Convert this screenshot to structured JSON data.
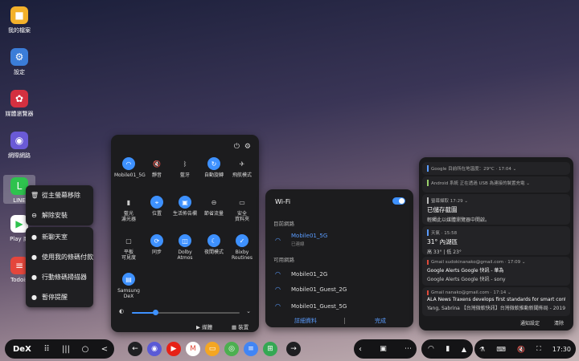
{
  "desktop": {
    "icons": [
      {
        "label": "我的檔案",
        "color": "#f3b12b",
        "glyph": "■"
      },
      {
        "label": "設定",
        "color": "#3b7dd8",
        "glyph": "⚙"
      },
      {
        "label": "媒體瀏覽器",
        "color": "#d43040",
        "glyph": "✿"
      },
      {
        "label": "網際網路",
        "color": "#6a5ad6",
        "glyph": "◉"
      },
      {
        "label": "LINE",
        "color": "#2ec24e",
        "glyph": "L"
      },
      {
        "label": "Play 商",
        "color": "#ffffff",
        "glyph": "▶"
      },
      {
        "label": "Todois",
        "color": "#e4463c",
        "glyph": "≡"
      }
    ]
  },
  "context_menu": {
    "group1": [
      {
        "label": "從主螢幕移除",
        "icon": "trash-icon"
      },
      {
        "label": "解除安裝",
        "icon": "minus-circle-icon"
      }
    ],
    "group2": [
      {
        "label": "新聊天室",
        "icon": "chat-icon"
      },
      {
        "label": "使用我的條碼付款",
        "icon": "barcode-icon"
      },
      {
        "label": "行動條碼掃描器",
        "icon": "scan-icon"
      },
      {
        "label": "暫停提醒",
        "icon": "pause-icon"
      }
    ]
  },
  "quick_panel": {
    "tiles": [
      {
        "label": "Mobile01_5G",
        "on": true,
        "glyph": "◠"
      },
      {
        "label": "靜音",
        "on": false,
        "glyph": "🔇"
      },
      {
        "label": "藍牙",
        "on": false,
        "glyph": "ᛒ"
      },
      {
        "label": "自動旋轉",
        "on": true,
        "glyph": "↻"
      },
      {
        "label": "飛航模式",
        "on": false,
        "glyph": "✈"
      },
      {
        "label": "藍光\n濾光器",
        "on": false,
        "glyph": "▮"
      },
      {
        "label": "位置",
        "on": true,
        "glyph": "⌖"
      },
      {
        "label": "生活佈告欄",
        "on": true,
        "glyph": "▣"
      },
      {
        "label": "節省流量",
        "on": false,
        "glyph": "⊖"
      },
      {
        "label": "安全\n資料夾",
        "on": false,
        "glyph": "▭"
      },
      {
        "label": "平板\n可見度",
        "on": false,
        "glyph": "▢"
      },
      {
        "label": "同步",
        "on": true,
        "glyph": "⟳"
      },
      {
        "label": "Dolby\nAtmos",
        "on": true,
        "glyph": "◫"
      },
      {
        "label": "夜間模式",
        "on": true,
        "glyph": "☾"
      },
      {
        "label": "Bixby\nRoutines",
        "on": true,
        "glyph": "✓"
      },
      {
        "label": "Samsung\nDeX",
        "on": true,
        "glyph": "▤"
      }
    ],
    "media_label": "媒體",
    "device_label": "裝置",
    "brightness": 0.22
  },
  "wifi_panel": {
    "title": "Wi-Fi",
    "current_header": "目前網路",
    "current_name": "Mobile01_5G",
    "current_status": "已連線",
    "available_header": "可用網路",
    "networks": [
      "Mobile01_2G",
      "Mobile01_Guest_2G",
      "Mobile01_Guest_5G"
    ],
    "details_label": "詳細資料",
    "done_label": "完成"
  },
  "notifications": {
    "cards": [
      {
        "src": "Google  目前所在地溫度：29°C · 17:04 ⌄",
        "title": "",
        "body": "",
        "accent": "#5a9cff"
      },
      {
        "src": "Android 系統  正在透過 USB 為連接的裝置充電 ⌄",
        "title": "",
        "body": "",
        "accent": "#9ad06a"
      },
      {
        "src": "螢幕擷取  17:29 ⌄",
        "title": "已儲存截圖",
        "body": "輕觸此以媒體瀏覽器中開啟。",
        "accent": "#bbbbbb"
      },
      {
        "src": "天氣 · 15:58",
        "title": "31° 內湖區",
        "body": "高 33° | 低 23°",
        "accent": "#5a9cff"
      },
      {
        "src": "Gmail  sudokinanako@gmail.com · 17:09 ⌄",
        "title": "Google Alerts  Google 快訊 - 華為",
        "body": "Google Alerts  Google 快訊 - sony",
        "accent": "#e04a3a"
      },
      {
        "src": "Gmail  nanako@gmail.com · 17:14 ⌄",
        "title": "ALA News  Traxens develops first standards for smart containe...",
        "body": "Yang, Sabrina  【台灣微軟快訊】台灣微軟推動新聞佈局 - 2019.1...",
        "accent": "#e04a3a"
      }
    ],
    "settings_label": "通知設定",
    "clear_label": "清除"
  },
  "taskbar": {
    "dex_label": "DeX",
    "apps": [
      {
        "name": "internet-app",
        "color": "#5a5ad6",
        "glyph": "◉"
      },
      {
        "name": "youtube-app",
        "color": "#e62117",
        "glyph": "▶"
      },
      {
        "name": "gmail-app",
        "color": "#ffffff",
        "glyph": "M"
      },
      {
        "name": "slides-app",
        "color": "#f4a623",
        "glyph": "▭"
      },
      {
        "name": "chrome-app",
        "color": "#4caf50",
        "glyph": "◎"
      },
      {
        "name": "docs-app",
        "color": "#4285f4",
        "glyph": "≡"
      },
      {
        "name": "sheets-app",
        "color": "#34a853",
        "glyph": "⊞"
      }
    ],
    "clock": "17:30"
  }
}
